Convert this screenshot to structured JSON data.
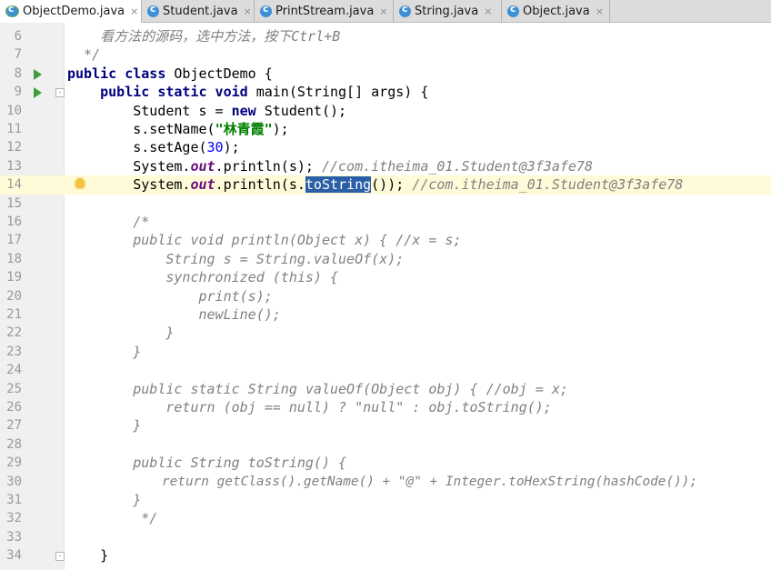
{
  "tabs": [
    {
      "label": "ObjectDemo.java",
      "active": true,
      "icon": "class-run-icon"
    },
    {
      "label": "Student.java",
      "active": false,
      "icon": "class-icon"
    },
    {
      "label": "PrintStream.java",
      "active": false,
      "icon": "class-icon"
    },
    {
      "label": "String.java",
      "active": false,
      "icon": "class-icon"
    },
    {
      "label": "Object.java",
      "active": false,
      "icon": "class-icon"
    }
  ],
  "tab_close_glyph": "×",
  "lines": [
    {
      "num": "6",
      "text": "    看方法的源码，选中方法，按下Ctrl+B"
    },
    {
      "num": "7",
      "text": "  */"
    },
    {
      "num": "8",
      "a": "public class",
      "b": " ObjectDemo {"
    },
    {
      "num": "9",
      "a": "    public static void",
      "b": " main(String[] args) {"
    },
    {
      "num": "10",
      "a": "        Student s = ",
      "k": "new",
      "b": " Student();"
    },
    {
      "num": "11",
      "a": "        s.setName(",
      "s": "\"林青霞\"",
      "b": ");"
    },
    {
      "num": "12",
      "a": "        s.setAge(",
      "n": "30",
      "b": ");"
    },
    {
      "num": "13",
      "a": "        System.",
      "f": "out",
      "b": ".println(s); ",
      "c": "//com.itheima_01.Student@3f3afe78"
    },
    {
      "num": "14",
      "a": "        System.",
      "f": "out",
      "b": ".println(s.",
      "sel": "toString",
      "b2": "()); ",
      "c": "//com.itheima_01.Student@3f3afe78"
    },
    {
      "num": "15",
      "text": ""
    },
    {
      "num": "16",
      "c": "        /*"
    },
    {
      "num": "17",
      "c": "        public void println(Object x) { //x = s;"
    },
    {
      "num": "18",
      "c": "            String s = String.valueOf(x);"
    },
    {
      "num": "19",
      "c": "            synchronized (this) {"
    },
    {
      "num": "20",
      "c": "                print(s);"
    },
    {
      "num": "21",
      "c": "                newLine();"
    },
    {
      "num": "22",
      "c": "            }"
    },
    {
      "num": "23",
      "c": "        }"
    },
    {
      "num": "24",
      "text": ""
    },
    {
      "num": "25",
      "c": "        public static String valueOf(Object obj) { //obj = x;"
    },
    {
      "num": "26",
      "c": "            return (obj == null) ? \"null\" : obj.toString();"
    },
    {
      "num": "27",
      "c": "        }"
    },
    {
      "num": "28",
      "text": ""
    },
    {
      "num": "29",
      "c": "        public String toString() {"
    },
    {
      "num": "30",
      "c": "            return getClass().getName() + \"@\" + Integer.toHexString(hashCode());"
    },
    {
      "num": "31",
      "c": "        }"
    },
    {
      "num": "32",
      "c": "         */"
    },
    {
      "num": "33",
      "text": ""
    },
    {
      "num": "34",
      "text": "    }"
    }
  ]
}
